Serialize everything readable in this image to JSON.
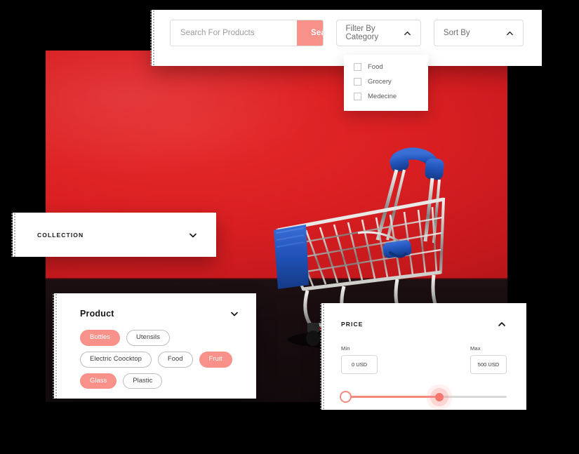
{
  "colors": {
    "accent": "#F79189",
    "backdrop_red": "#DD1F22",
    "floor_dark": "#1A1012",
    "panel_white": "#FFFFFF",
    "cart_blue": "#1E50B4"
  },
  "search_panel": {
    "input_value": "",
    "input_placeholder": "Search For Products",
    "search_button": "Search",
    "category_select": {
      "label": "Filter By Category",
      "state": "expanded",
      "options": [
        {
          "label": "Food",
          "checked": false
        },
        {
          "label": "Grocery",
          "checked": false
        },
        {
          "label": "Medecine",
          "checked": false
        }
      ]
    },
    "sort_select": {
      "label": "Sort By",
      "state": "expanded"
    }
  },
  "collection_panel": {
    "title": "COLLECTION",
    "state": "collapsed"
  },
  "product_panel": {
    "title": "Product",
    "state": "collapsed",
    "tags": [
      {
        "label": "Bottles",
        "selected": true
      },
      {
        "label": "Utensils",
        "selected": false
      },
      {
        "label": "Electric Coocktop",
        "selected": false
      },
      {
        "label": "Food",
        "selected": false
      },
      {
        "label": "Fruit",
        "selected": true
      },
      {
        "label": "Glass",
        "selected": true
      },
      {
        "label": "Plastic",
        "selected": false
      }
    ]
  },
  "price_panel": {
    "title": "PRICE",
    "state": "expanded",
    "min_label": "Min",
    "min_value": "0 USD",
    "max_label": "Max",
    "max_value": "500 USD",
    "slider": {
      "min": 0,
      "max": 500,
      "low": 0,
      "high": 300
    }
  },
  "backdrop": {
    "subject": "shopping-cart-photo"
  }
}
